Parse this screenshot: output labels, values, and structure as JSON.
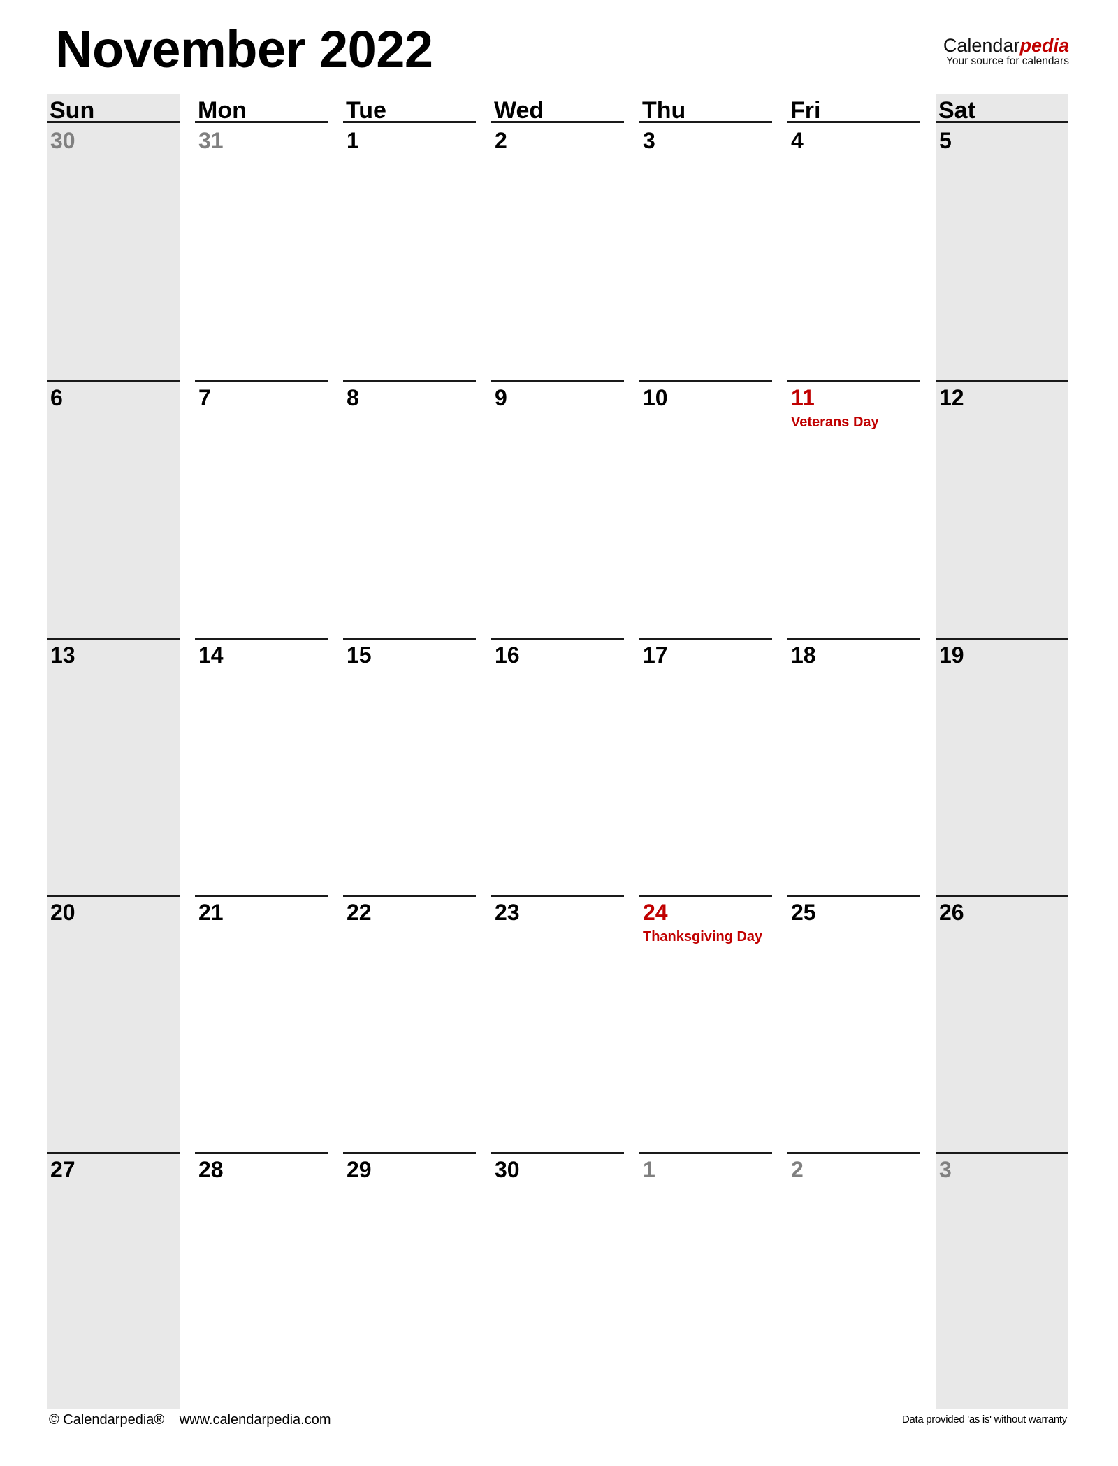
{
  "header": {
    "title": "November 2022",
    "brand_prefix": "Calendar",
    "brand_suffix": "pedia",
    "brand_tagline": "Your source for calendars"
  },
  "colors": {
    "holiday": "#c00000",
    "muted": "#808080",
    "weekend_bg": "#e8e8e8"
  },
  "weekdays": [
    "Sun",
    "Mon",
    "Tue",
    "Wed",
    "Thu",
    "Fri",
    "Sat"
  ],
  "weeks": [
    [
      {
        "day": "30",
        "muted": true
      },
      {
        "day": "31",
        "muted": true
      },
      {
        "day": "1"
      },
      {
        "day": "2"
      },
      {
        "day": "3"
      },
      {
        "day": "4"
      },
      {
        "day": "5"
      }
    ],
    [
      {
        "day": "6"
      },
      {
        "day": "7"
      },
      {
        "day": "8"
      },
      {
        "day": "9"
      },
      {
        "day": "10"
      },
      {
        "day": "11",
        "holiday": "Veterans Day"
      },
      {
        "day": "12"
      }
    ],
    [
      {
        "day": "13"
      },
      {
        "day": "14"
      },
      {
        "day": "15"
      },
      {
        "day": "16"
      },
      {
        "day": "17"
      },
      {
        "day": "18"
      },
      {
        "day": "19"
      }
    ],
    [
      {
        "day": "20"
      },
      {
        "day": "21"
      },
      {
        "day": "22"
      },
      {
        "day": "23"
      },
      {
        "day": "24",
        "holiday": "Thanksgiving Day"
      },
      {
        "day": "25"
      },
      {
        "day": "26"
      }
    ],
    [
      {
        "day": "27"
      },
      {
        "day": "28"
      },
      {
        "day": "29"
      },
      {
        "day": "30"
      },
      {
        "day": "1",
        "muted": true
      },
      {
        "day": "2",
        "muted": true
      },
      {
        "day": "3",
        "muted": true
      }
    ]
  ],
  "footer": {
    "copyright": "© Calendarpedia®",
    "website": "www.calendarpedia.com",
    "disclaimer": "Data provided 'as is' without warranty"
  }
}
